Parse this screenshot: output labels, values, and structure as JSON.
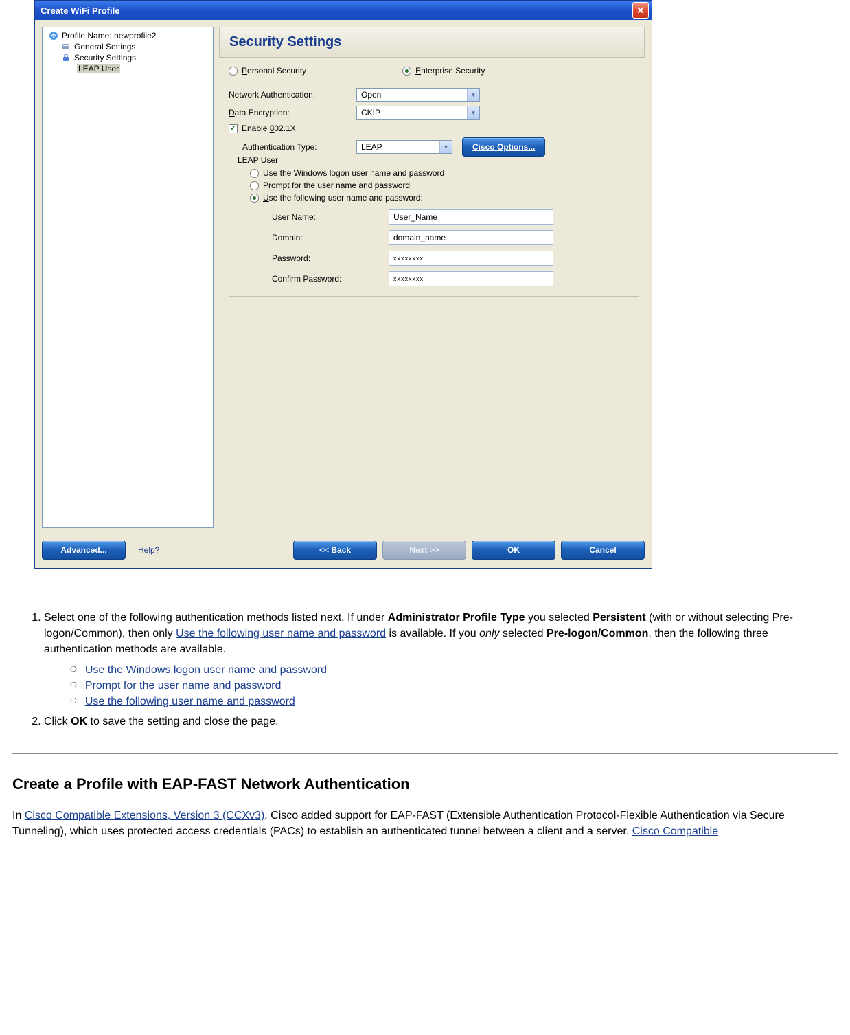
{
  "dialog": {
    "title": "Create WiFi Profile",
    "tree": {
      "profile_label": "Profile Name:",
      "profile_value": "newprofile2",
      "general": "General Settings",
      "security": "Security Settings",
      "leap_user": "LEAP User"
    },
    "header": "Security Settings",
    "security_mode": {
      "personal": "Personal Security",
      "enterprise": "Enterprise Security"
    },
    "labels": {
      "network_auth": "Network Authentication:",
      "data_encryption": "Data Encryption:",
      "enable_8021x": "Enable 802.1X",
      "auth_type": "Authentication Type:"
    },
    "selects": {
      "network_auth": "Open",
      "data_encryption": "CKIP",
      "auth_type": "LEAP"
    },
    "cisco_button": "Cisco Options...",
    "fieldset": {
      "legend": "LEAP User",
      "opt_windows": "Use the Windows logon user name and password",
      "opt_prompt": "Prompt for the user name and password",
      "opt_following": "Use the following user name and password:",
      "user_name_label": "User Name:",
      "user_name_value": "User_Name",
      "domain_label": "Domain:",
      "domain_value": "domain_name",
      "password_label": "Password:",
      "password_value": "xxxxxxxx",
      "confirm_label": "Confirm Password:",
      "confirm_value": "xxxxxxxx"
    },
    "footer": {
      "advanced": "Advanced...",
      "help": "Help?",
      "back": "<< Back",
      "next": "Next >>",
      "ok": "OK",
      "cancel": "Cancel"
    }
  },
  "doc": {
    "step1_pre": "Select one of the following authentication methods listed next. If under ",
    "step1_b1": "Administrator Profile Type",
    "step1_mid1": " you selected ",
    "step1_b2": "Persistent",
    "step1_mid2": " (with or without selecting Pre-logon/Common), then only ",
    "step1_link1": "Use the following user name and password",
    "step1_mid3": " is available. If you ",
    "step1_i1": "only",
    "step1_mid4": " selected ",
    "step1_b3": "Pre-logon/Common",
    "step1_mid5": ", then the following three authentication methods are available.",
    "sub1": "Use the Windows logon user name and password",
    "sub2": "Prompt for the user name and password",
    "sub3": "Use the following user name and password",
    "step2_pre": "Click ",
    "step2_b1": "OK",
    "step2_post": " to save the setting and close the page.",
    "h2": "Create a Profile with EAP-FAST Network Authentication",
    "p_pre": "In ",
    "p_link1": "Cisco Compatible Extensions, Version 3 (CCXv3)",
    "p_mid": ", Cisco added support for EAP-FAST (Extensible Authentication Protocol-Flexible Authentication via Secure Tunneling), which uses protected access credentials (PACs) to establish an authenticated tunnel between a client and a server. ",
    "p_link2": "Cisco Compatible "
  }
}
